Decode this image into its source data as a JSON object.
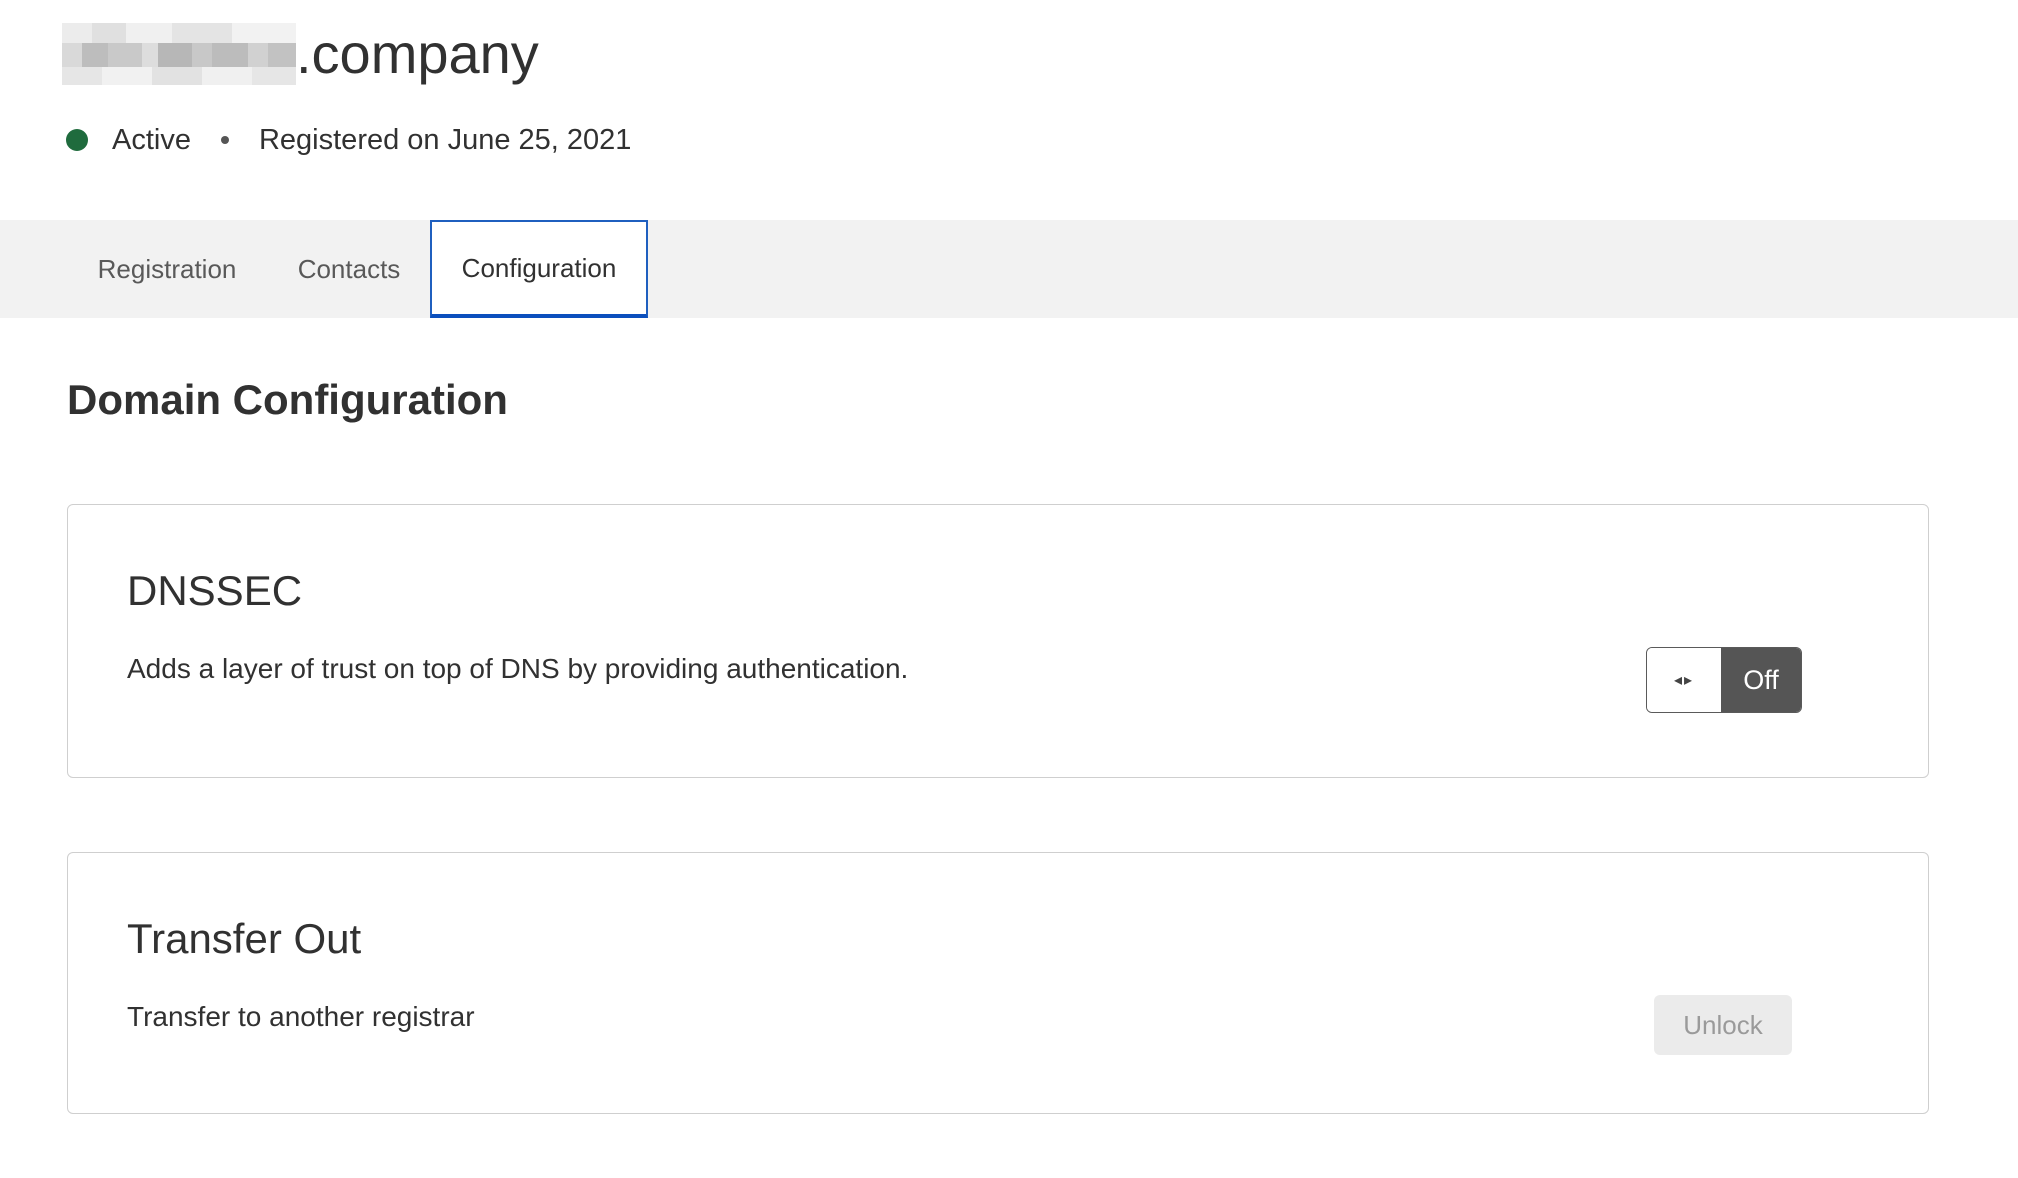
{
  "header": {
    "domain_suffix": ".company",
    "status": "Active",
    "registered": "Registered on June 25, 2021",
    "status_color": "#1f6b3d"
  },
  "tabs": [
    {
      "label": "Registration",
      "active": false
    },
    {
      "label": "Contacts",
      "active": false
    },
    {
      "label": "Configuration",
      "active": true
    }
  ],
  "main": {
    "title": "Domain Configuration",
    "cards": {
      "dnssec": {
        "title": "DNSSEC",
        "description": "Adds a layer of trust on top of DNS by providing authentication.",
        "toggle_icon": "arrows-left-right-icon",
        "toggle_state": "Off"
      },
      "transfer": {
        "title": "Transfer Out",
        "description": "Transfer to another registrar",
        "button_label": "Unlock",
        "button_disabled": true
      }
    }
  },
  "colors": {
    "tab_active_border": "#0b4fbd",
    "tab_bar_bg": "#f2f2f2",
    "toggle_off_bg": "#555555"
  }
}
